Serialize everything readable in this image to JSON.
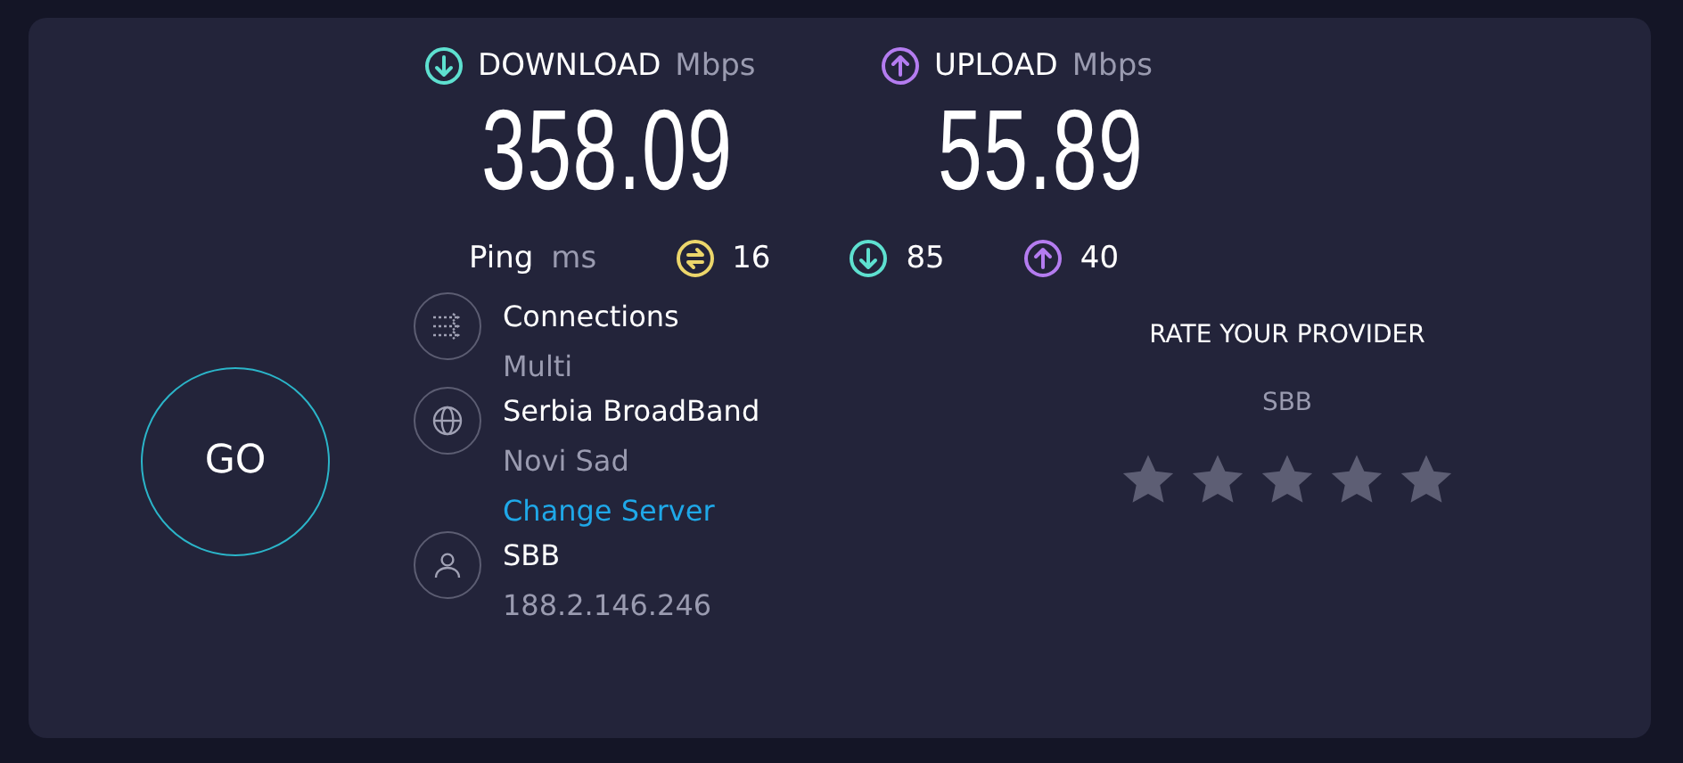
{
  "results": [
    {
      "kind": "download",
      "label": "DOWNLOAD",
      "unit": "Mbps",
      "value": "358.09"
    },
    {
      "kind": "upload",
      "label": "UPLOAD",
      "unit": "Mbps",
      "value": "55.89"
    }
  ],
  "ping": {
    "label": "Ping",
    "unit": "ms",
    "items": [
      {
        "kind": "ping",
        "value": "16"
      },
      {
        "kind": "download",
        "value": "85"
      },
      {
        "kind": "upload",
        "value": "40"
      }
    ]
  },
  "go_button": "GO",
  "info": [
    {
      "kind": "connections",
      "title": "Connections",
      "detail": "Multi"
    },
    {
      "kind": "server",
      "title": "Serbia BroadBand",
      "detail": "Novi Sad",
      "link": "Change Server"
    },
    {
      "kind": "user",
      "title": "SBB",
      "detail": "188.2.146.246"
    }
  ],
  "rating": {
    "title": "RATE YOUR PROVIDER",
    "provider": "SBB",
    "stars": 0
  }
}
